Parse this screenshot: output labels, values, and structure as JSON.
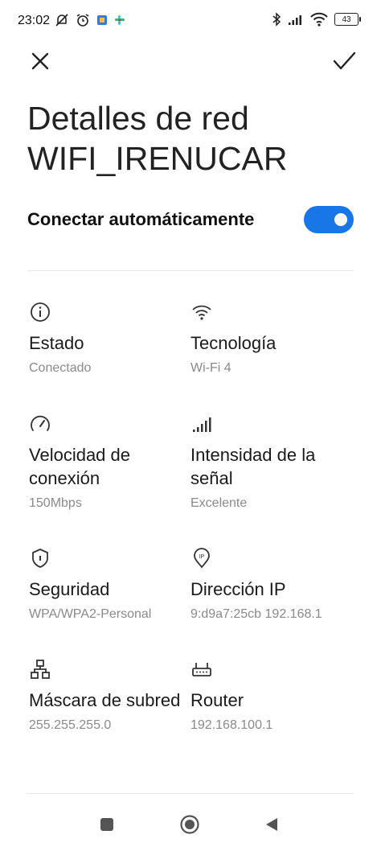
{
  "status_bar": {
    "time": "23:02",
    "battery": "43",
    "left_icons": [
      "muted-bell-icon",
      "alarm-icon",
      "app-icon",
      "slack-icon"
    ],
    "right_icons": [
      "bluetooth-icon",
      "signal-icon",
      "wifi-icon",
      "battery-icon"
    ]
  },
  "header": {
    "close_icon": "close-icon",
    "confirm_icon": "check-icon"
  },
  "title": {
    "line1": "Detalles de red",
    "line2": "WIFI_IRENUCAR"
  },
  "auto_connect": {
    "label": "Conectar automáticamente",
    "enabled": true,
    "accent_color": "#1976e6"
  },
  "details": {
    "estado": {
      "label": "Estado",
      "value": "Conectado",
      "icon": "info-icon"
    },
    "tecnologia": {
      "label": "Tecnología",
      "value": "Wi-Fi 4",
      "icon": "wifi-icon"
    },
    "velocidad": {
      "label": "Velocidad de conexión",
      "value": "150Mbps",
      "icon": "speedometer-icon"
    },
    "intensidad": {
      "label": "Intensidad de la señal",
      "value": "Excelente",
      "icon": "signal-strength-icon"
    },
    "seguridad": {
      "label": "Seguridad",
      "value": "WPA/WPA2-Personal",
      "icon": "shield-icon"
    },
    "ip": {
      "label": "Dirección IP",
      "value": "9:d9a7:25cb 192.168.1",
      "icon": "ip-pin-icon"
    },
    "mascara": {
      "label": "Máscara de subred",
      "value": "255.255.255.0",
      "icon": "network-tree-icon"
    },
    "router": {
      "label": "Router",
      "value": "192.168.100.1",
      "icon": "router-icon"
    }
  },
  "nav_bar": {
    "icons": [
      "recents-icon",
      "home-icon",
      "back-icon"
    ]
  }
}
